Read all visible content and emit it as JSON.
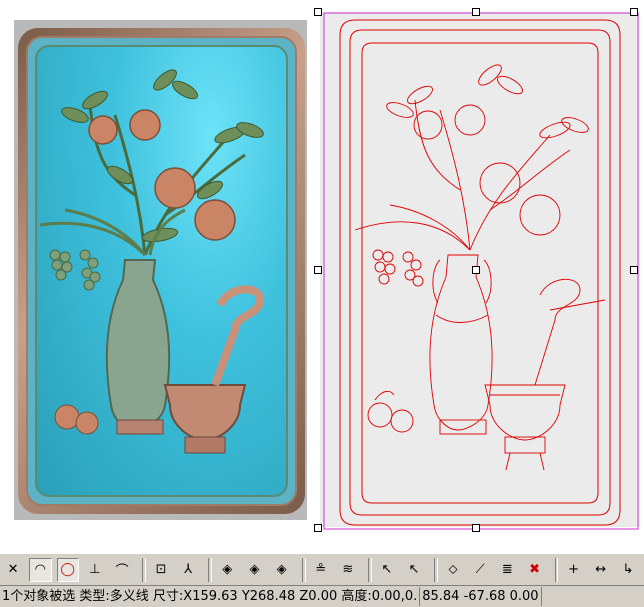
{
  "status": {
    "selection_text": "1个对象被选 类型:多义线 尺寸:X159.63 Y268.48 Z0.00 高度:0.00,0.",
    "coords_text": "85.84 -67.68 0.00"
  },
  "toolbar": [
    {
      "icon": "cross-lines-icon",
      "active": false,
      "glyph": "✕"
    },
    {
      "icon": "arc-icon",
      "active": true,
      "glyph": "◠"
    },
    {
      "icon": "circle-icon",
      "active": true,
      "glyph": "◯"
    },
    {
      "icon": "perpendicular-icon",
      "active": false,
      "glyph": "⊥"
    },
    {
      "icon": "tangent-icon",
      "active": false,
      "glyph": "⌒"
    },
    {
      "icon": "node-icon",
      "active": false,
      "glyph": "⊡"
    },
    {
      "icon": "branch-node-icon",
      "active": false,
      "glyph": "⅄"
    },
    {
      "icon": "diamond-1-icon",
      "active": false,
      "glyph": "◈"
    },
    {
      "icon": "diamond-2-icon",
      "active": false,
      "glyph": "◈"
    },
    {
      "icon": "diamond-3-icon",
      "active": false,
      "glyph": "◈"
    },
    {
      "icon": "layer-align-icon",
      "active": false,
      "glyph": "≗"
    },
    {
      "icon": "layer-offset-icon",
      "active": false,
      "glyph": "≋"
    },
    {
      "icon": "select-arrow-icon",
      "active": false,
      "glyph": "↖"
    },
    {
      "icon": "deselect-arrow-icon",
      "active": false,
      "glyph": "↖"
    },
    {
      "icon": "transform-1-icon",
      "active": false,
      "glyph": "⬦"
    },
    {
      "icon": "transform-2-icon",
      "active": false,
      "glyph": "⟋"
    },
    {
      "icon": "list-edit-icon",
      "active": false,
      "glyph": "≣"
    },
    {
      "icon": "delete-icon",
      "active": false,
      "glyph": "✖"
    },
    {
      "icon": "add-point-icon",
      "active": false,
      "glyph": "+"
    },
    {
      "icon": "measure-icon",
      "active": false,
      "glyph": "↔"
    },
    {
      "icon": "corner-icon",
      "active": false,
      "glyph": "↳"
    }
  ]
}
